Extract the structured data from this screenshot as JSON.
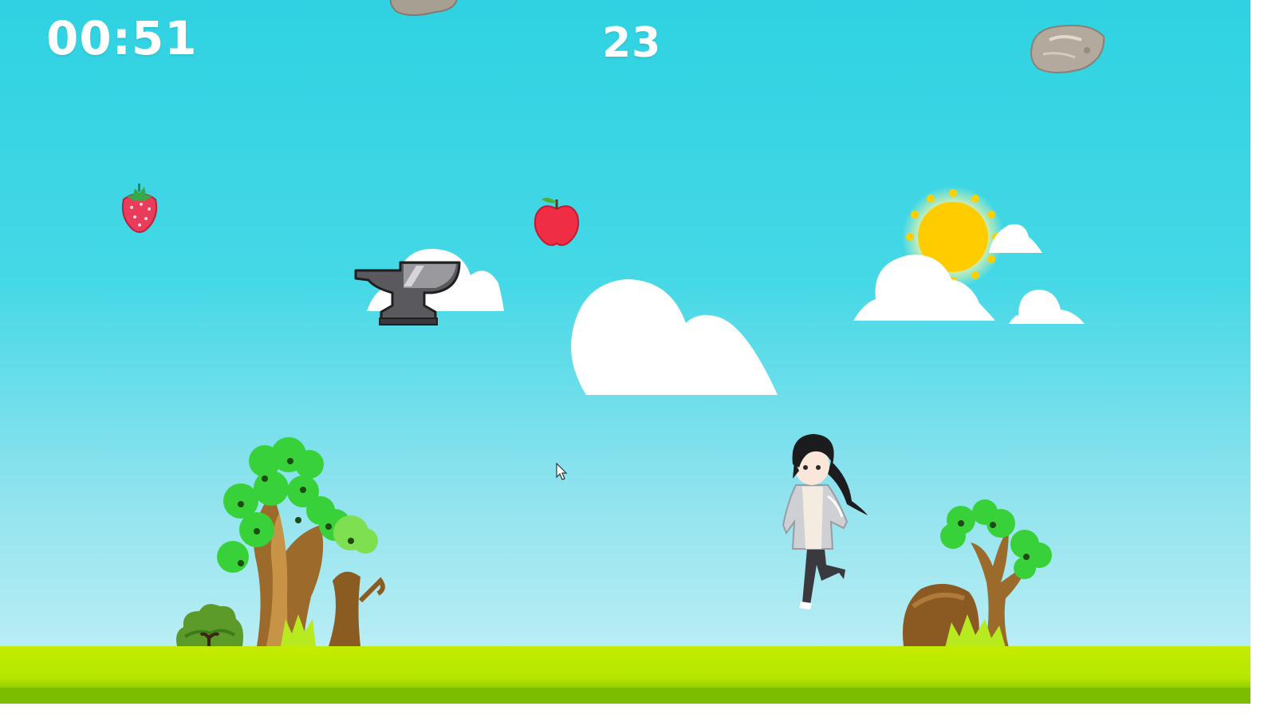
{
  "hud": {
    "timer": "00:51",
    "score": "23"
  },
  "objects": {
    "falling_items": [
      "rock",
      "rock",
      "strawberry",
      "apple",
      "anvil"
    ],
    "background": [
      "sun",
      "cloud",
      "cloud",
      "cloud",
      "cloud",
      "tree",
      "tree",
      "bush",
      "boulder"
    ],
    "player": "anime-girl-character"
  },
  "colors": {
    "sky_top": "#2fd2e2",
    "sky_bottom": "#c8f1f6",
    "grass": "#b6e600",
    "sun": "#ffd000",
    "hud_text": "#ffffff"
  }
}
